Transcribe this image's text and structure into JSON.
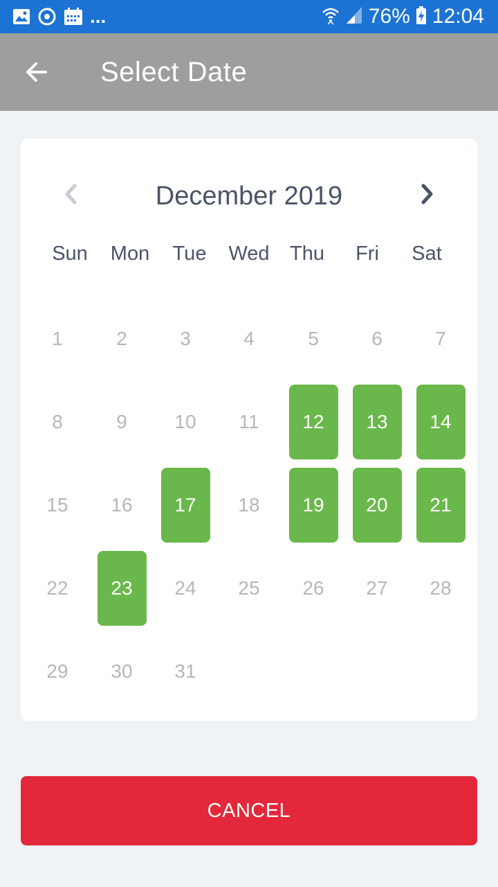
{
  "status_bar": {
    "battery": "76%",
    "time": "12:04",
    "overflow": "...",
    "icons": [
      "image-icon",
      "sync-icon",
      "calendar-icon",
      "wifi-icon",
      "signal-icon",
      "battery-charging-icon"
    ]
  },
  "app_bar": {
    "title": "Select Date",
    "back_icon": "arrow-left-icon"
  },
  "calendar": {
    "month_label": "December 2019",
    "prev_icon": "chevron-left-icon",
    "next_icon": "chevron-right-icon",
    "weekdays": [
      "Sun",
      "Mon",
      "Tue",
      "Wed",
      "Thu",
      "Fri",
      "Sat"
    ],
    "days": [
      {
        "label": "1",
        "available": false
      },
      {
        "label": "2",
        "available": false
      },
      {
        "label": "3",
        "available": false
      },
      {
        "label": "4",
        "available": false
      },
      {
        "label": "5",
        "available": false
      },
      {
        "label": "6",
        "available": false
      },
      {
        "label": "7",
        "available": false
      },
      {
        "label": "8",
        "available": false
      },
      {
        "label": "9",
        "available": false
      },
      {
        "label": "10",
        "available": false
      },
      {
        "label": "11",
        "available": false
      },
      {
        "label": "12",
        "available": true
      },
      {
        "label": "13",
        "available": true
      },
      {
        "label": "14",
        "available": true
      },
      {
        "label": "15",
        "available": false
      },
      {
        "label": "16",
        "available": false
      },
      {
        "label": "17",
        "available": true
      },
      {
        "label": "18",
        "available": false
      },
      {
        "label": "19",
        "available": true
      },
      {
        "label": "20",
        "available": true
      },
      {
        "label": "21",
        "available": true
      },
      {
        "label": "22",
        "available": false
      },
      {
        "label": "23",
        "available": true
      },
      {
        "label": "24",
        "available": false
      },
      {
        "label": "25",
        "available": false
      },
      {
        "label": "26",
        "available": false
      },
      {
        "label": "27",
        "available": false
      },
      {
        "label": "28",
        "available": false
      },
      {
        "label": "29",
        "available": false
      },
      {
        "label": "30",
        "available": false
      },
      {
        "label": "31",
        "available": false
      }
    ]
  },
  "cancel_label": "CANCEL",
  "colors": {
    "status_bar": "#1c73d3",
    "app_bar": "#9e9e9e",
    "available_day": "#6ab84b",
    "cancel": "#e2283a",
    "text_dark": "#4b5367",
    "text_disabled": "#b5b7bd"
  }
}
